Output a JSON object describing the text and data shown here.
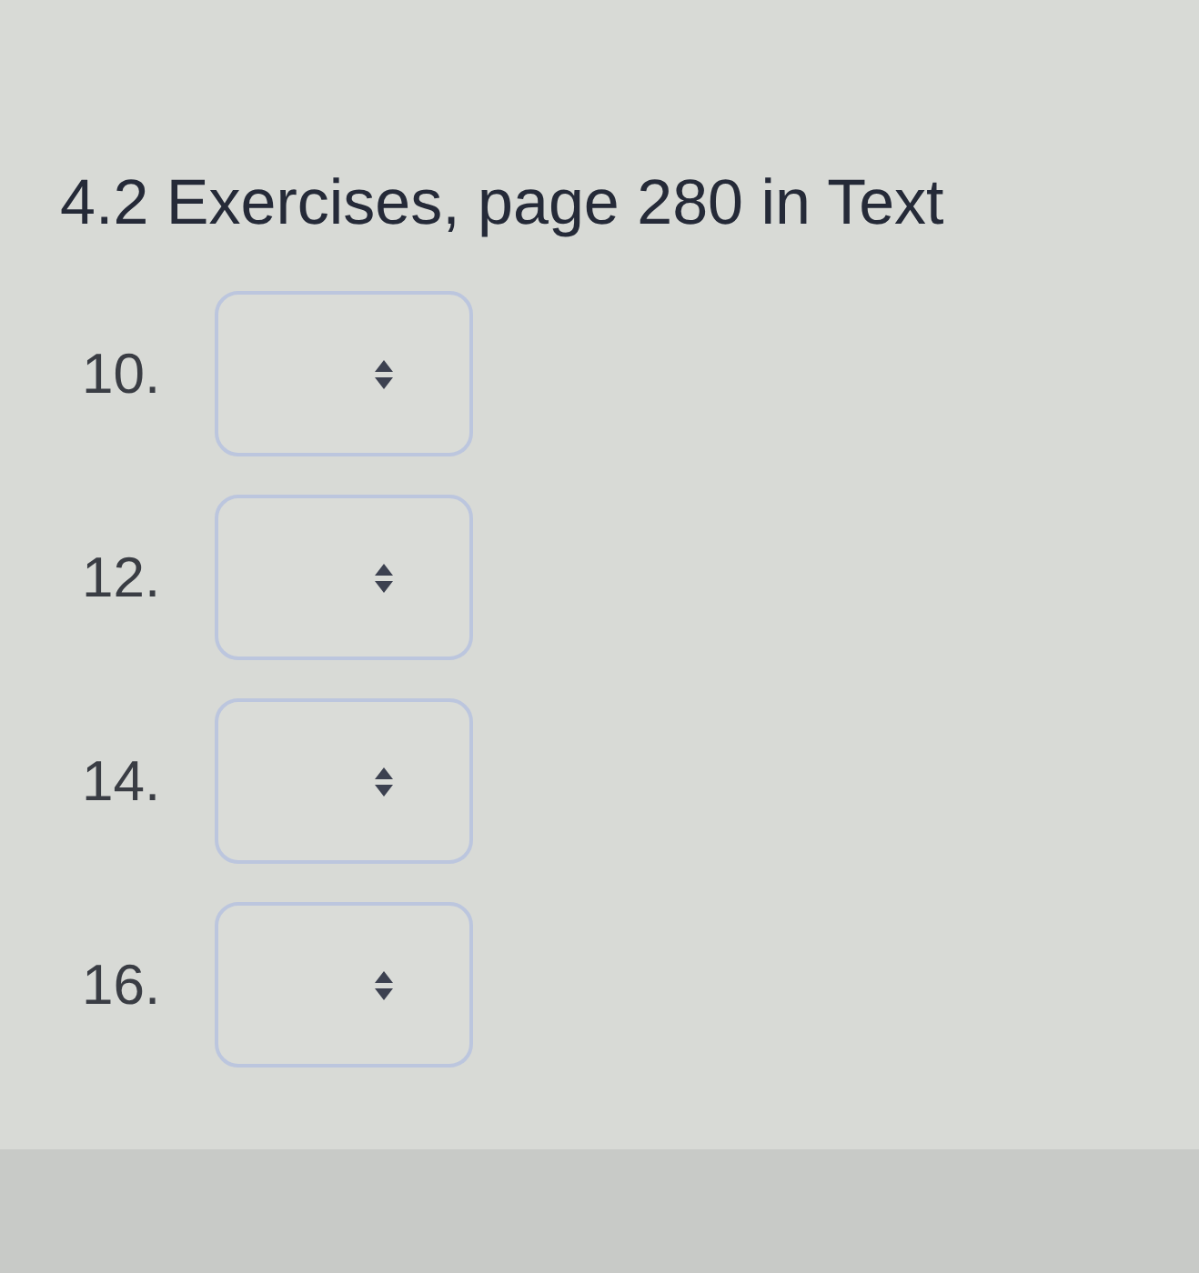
{
  "heading": "4.2 Exercises, page 280 in Text",
  "questions": [
    {
      "number": "10."
    },
    {
      "number": "12."
    },
    {
      "number": "14."
    },
    {
      "number": "16."
    }
  ]
}
